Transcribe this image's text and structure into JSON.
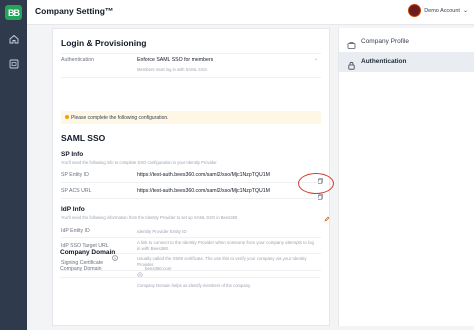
{
  "app": {
    "logo_text": "BB",
    "page_title": "Company Setting™"
  },
  "account": {
    "label": "Demo Account"
  },
  "colors": {
    "brand": "#23a559",
    "sidebar": "#2f3b4c",
    "warn_bg": "#fff7e6",
    "highlight": "#d03a2f"
  },
  "login": {
    "title": "Login & Provisioning",
    "auth_label": "Authentication",
    "auth_value": "Enforce SAML SSO for members",
    "auth_help": "Members must log in with SAML SSO."
  },
  "warning": {
    "text": "Please complete the following configuration."
  },
  "saml": {
    "title": "SAML SSO",
    "sp_title": "SP Info",
    "sp_help": "You'll need the following info to complete SSO configuration in your Identity Provider.",
    "entity_label": "SP Entity ID",
    "entity_value": "https://test-auth.bees360.com/saml2/sso/Mjc1NzpTQU1M",
    "acs_label": "SP ACS URL",
    "acs_value": "https://test-auth.bees360.com/saml2/sso/Mjc1NzpTQU1M",
    "idp_title": "IdP Info",
    "idp_help": "You'll need the following information from the Identity Provider to set up SAML SSO in Bees360.",
    "idp_entity_label": "IdP Entity ID",
    "idp_entity_placeholder": "Identity Provider Entity ID",
    "idp_target_label": "IdP SSO Target URL",
    "idp_target_placeholder": "A link to connect to the Identity Provider when someone from your company attempts to log in with Bees360.",
    "cert_label": "Signing Certificate",
    "cert_placeholder": "Usually called the X509 certificate. The use this to verify your company via your Identity Provider."
  },
  "domain": {
    "title": "Company Domain",
    "label": "Company Domain",
    "placeholder": "bees360.com",
    "help": "Company Domain helps us identify members of the company."
  },
  "nav": {
    "items": [
      {
        "label": "Company Profile",
        "icon": "company-profile-icon"
      },
      {
        "label": "Authentication",
        "icon": "lock-icon"
      }
    ]
  }
}
